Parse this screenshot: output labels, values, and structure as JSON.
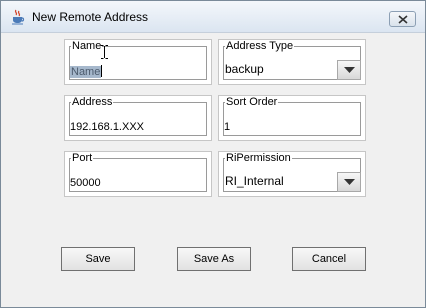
{
  "window": {
    "title": "New Remote Address"
  },
  "fields": {
    "name": {
      "label": "Name",
      "value": "Name"
    },
    "address_type": {
      "label": "Address Type",
      "value": "backup"
    },
    "address": {
      "label": "Address",
      "value": "192.168.1.XXX"
    },
    "sort_order": {
      "label": "Sort Order",
      "value": "1"
    },
    "port": {
      "label": "Port",
      "value": "50000"
    },
    "ri_permission": {
      "label": "RiPermission",
      "value": "RI_Internal"
    }
  },
  "buttons": {
    "save": "Save",
    "save_as": "Save As",
    "cancel": "Cancel"
  },
  "icons": {
    "app": "java-cup-icon",
    "close": "close-icon",
    "dropdown": "chevron-down-icon",
    "cursor": "text-cursor-icon"
  }
}
